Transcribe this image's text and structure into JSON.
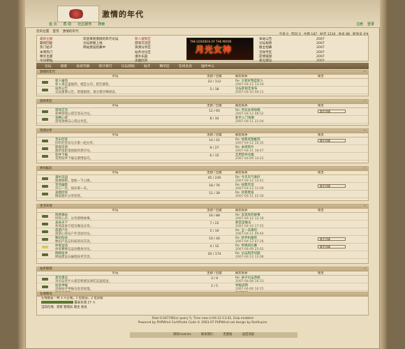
{
  "header": {
    "site_title": "激情的年代",
    "nav": [
      "首 页",
      "帮 助",
      "社区服务",
      "搜索"
    ],
    "nav_right": [
      "注册",
      "登录"
    ]
  },
  "crumb": [
    "您的位置",
    "首页",
    "激情的年代"
  ],
  "stats": [
    "今日 0",
    "昨日 0",
    "主题 187",
    "帖子 1234",
    "会员 88",
    "新会员 ##"
  ],
  "notice": {
    "left": [
      "最新主题",
      "最新回复",
      "热门帖子",
      "本周热门",
      "精华主题",
      "今日新帖"
    ],
    "left_items": [
      "欢迎来到激情的年代论坛",
      "论坛新版上线",
      "网站建设招募中"
    ],
    "mid": [
      "新人报到区",
      "游戏交流区",
      "资源分享区",
      "站务讨论区",
      "灌水乐园",
      "美图欣赏"
    ],
    "right": [
      "本站公告",
      "论坛规则",
      "版主招募",
      "活动专区",
      "友情链接",
      "意见建议"
    ],
    "right_dates": [
      "2007",
      "2007",
      "2007",
      "2007",
      "2007",
      "2007"
    ],
    "banner_text": "月光女神",
    "banner_sub": "THE GODDESS OF THE MOON"
  },
  "tabs": [
    "论坛",
    "搜索",
    "会员列表",
    "统计排行",
    "论坛帮助",
    "帖子",
    "精华区",
    "在线会员",
    "插件中心"
  ],
  "columns": [
    "论坛",
    "主题 / 回复",
    "最后发表",
    "版主"
  ],
  "sections": [
    {
      "name": "激情的年代",
      "forums": [
        {
          "title": "新人报到",
          "desc": "新人来这里报到，相互认识，结交朋友。",
          "count": "23 / 112",
          "last_title": "Re: 大家好我是新人",
          "last_date": "2007-04-12 13:20",
          "hot": false
        },
        {
          "title": "站务公告",
          "desc": "论坛重要公告，管理规则，请大家仔细阅读。",
          "count": "5 / 18",
          "last_title": "论坛新规定发布",
          "last_date": "2007-04-10 09:11",
          "hot": false
        }
      ]
    },
    {
      "name": "游戏专区",
      "forums": [
        {
          "title": "游戏交流",
          "desc": "各种游戏心得交流与讨论。",
          "count": "12 / 60",
          "last_title": "Re: 月光女神攻略",
          "last_date": "2007-04-12 08:52",
          "hot": false,
          "mod": "版主列表"
        },
        {
          "title": "攻略心得",
          "desc": "游戏攻略与心得分享区。",
          "count": "8 / 34",
          "last_title": "新手入门攻略",
          "last_date": "2007-04-11 21:04",
          "hot": false
        }
      ]
    },
    {
      "name": "资源分享",
      "forums": [
        {
          "title": "音乐欣赏",
          "desc": "好听的音乐与大家一起分享。",
          "count": "14 / 41",
          "last_title": "Re: 经典老歌推荐",
          "last_date": "2007-04-12 10:35",
          "hot": false,
          "mod": "版主列表"
        },
        {
          "title": "影视天地",
          "desc": "最新电影电视剧资源讨论。",
          "count": "9 / 27",
          "last_title": "Re: 本周新片",
          "last_date": "2007-04-11 18:47",
          "hot": false
        },
        {
          "title": "软件下载",
          "desc": "常用软件下载与使用技巧。",
          "count": "6 / 15",
          "last_title": "实用软件合集",
          "last_date": "2007-04-09 14:22",
          "hot": false
        }
      ]
    },
    {
      "name": "休闲娱乐",
      "forums": [
        {
          "title": "灌水乐园",
          "desc": "随便聊聊，放松一下心情。",
          "count": "45 / 230",
          "last_title": "Re: 今天天气真好",
          "last_date": "2007-04-12 13:41",
          "hot": false
        },
        {
          "title": "笑话幽默",
          "desc": "开心一笑，快乐每一天。",
          "count": "18 / 76",
          "last_title": "Re: 经典笑话",
          "last_date": "2007-04-12 11:09",
          "hot": false,
          "mod": "版主列表"
        },
        {
          "title": "美图欣赏",
          "desc": "精美图片分享欣赏。",
          "count": "11 / 39",
          "last_title": "Re: 风景壁纸",
          "last_date": "2007-04-11 22:30",
          "hot": false
        }
      ]
    },
    {
      "name": "生活天地",
      "forums": [
        {
          "title": "情感驿站",
          "desc": "倾诉心声，分享感情故事。",
          "count": "16 / 88",
          "last_title": "Re: 说说你的故事",
          "last_date": "2007-04-12 12:18",
          "hot": false
        },
        {
          "title": "美食天下",
          "desc": "各地美食介绍与做法分享。",
          "count": "7 / 22",
          "last_title": "家常菜做法",
          "last_date": "2007-04-10 17:55",
          "hot": false
        },
        {
          "title": "旅游户外",
          "desc": "旅游心得与户外活动讨论。",
          "count": "5 / 19",
          "last_title": "Re: 五一去哪玩",
          "last_date": "2007-04-11 09:40",
          "hot": false
        },
        {
          "title": "数码科技",
          "desc": "数码产品与科技资讯交流。",
          "count": "10 / 44",
          "last_title": "Re: 新手机推荐",
          "last_date": "2007-04-12 07:26",
          "hot": false,
          "mod": "版主列表"
        },
        {
          "title": "体育运动",
          "desc": "体育赛事与运动健身讨论。",
          "count": "4 / 12",
          "last_title": "Re: 昨晚的比赛",
          "last_date": "2007-04-09 23:02",
          "hot": true,
          "mod": "版主列表"
        },
        {
          "title": "网络技术",
          "desc": "网站建设与编程技术交流。",
          "count": "20 / 174",
          "last_title": "Re: 论坛程序问题",
          "last_date": "2007-04-12 13:08",
          "hot": false
        }
      ]
    },
    {
      "name": "站务管理",
      "forums": [
        {
          "title": "意见建议",
          "desc": "对论坛有什么意见和建议请在这里提出。",
          "count": "3 / 9",
          "last_title": "Re: 关于论坛改版",
          "last_date": "2007-04-08 16:33",
          "hot": false
        },
        {
          "title": "投诉举报",
          "desc": "违规帖子举报与投诉处理。",
          "count": "2 / 5",
          "last_title": "举报说明",
          "last_date": "2007-04-06 10:15",
          "hot": false
        },
        {
          "title": "管理员专区",
          "desc": "管理人员工作交流区。",
          "count": "1 / 3",
          "last_title": "工作安排",
          "last_date": "2007-04-05 20:48",
          "hot": false
        }
      ]
    }
  ],
  "online": {
    "head": "在线情况",
    "line1": "在线会员 - 共 3 人在线，1 位会员，2 位游客",
    "line2": "最高在线 27 人",
    "line3": "当前在线：游客  管理员  版主  会员"
  },
  "footer": {
    "line1": "Total 0.047766(s) query 5, Time now is:04-12 13:42, Gzip enabled",
    "line2": "Powered by PHPWind    Certificate Code    © 2003-07 PHPWind.net    design by Redlinpire",
    "links": [
      "清除Cookies",
      "联系我们",
      "无图版",
      "返回顶部"
    ]
  }
}
